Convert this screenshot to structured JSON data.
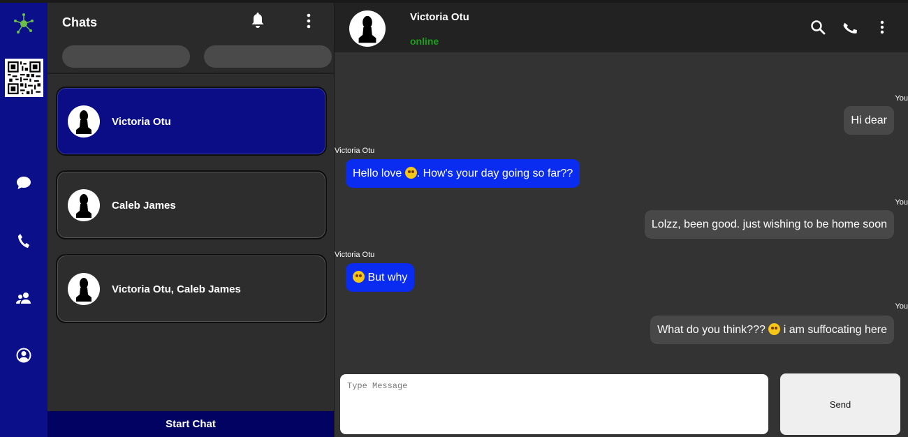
{
  "rail": {
    "icons": [
      "network-logo-icon",
      "qr-code-icon",
      "chat-icon",
      "phone-icon",
      "contacts-icon",
      "profile-icon"
    ],
    "accent": "#0b0f8a"
  },
  "chats_panel": {
    "title": "Chats",
    "items": [
      {
        "name": "Victoria Otu",
        "active": true
      },
      {
        "name": "Caleb James",
        "active": false
      },
      {
        "name": "Victoria Otu, Caleb James",
        "active": false
      }
    ],
    "start_chat_label": "Start Chat"
  },
  "conversation": {
    "contact_name": "Victoria Otu",
    "status": "online",
    "status_color": "#1b9e1b",
    "messages": [
      {
        "sender": "You",
        "direction": "out",
        "text": "Hi dear"
      },
      {
        "sender": "Victoria Otu",
        "direction": "in",
        "text_before": "Hello love ",
        "emoji": "star-struck-emoji",
        "text_after": ". How's your day going so far??"
      },
      {
        "sender": "You",
        "direction": "out",
        "text": "Lolzz, been good. just wishing to be home soon"
      },
      {
        "sender": "Victoria Otu",
        "direction": "in",
        "emoji": "rofl-emoji",
        "text_after": " But why"
      },
      {
        "sender": "You",
        "direction": "out",
        "text_before": "What do you think??? ",
        "emoji": "rofl-emoji",
        "text_after": " i am suffocating here"
      }
    ],
    "composer_placeholder": "Type Message",
    "send_label": "Send",
    "incoming_bubble_color": "#0a2cf0",
    "outgoing_bubble_color": "#484848"
  }
}
